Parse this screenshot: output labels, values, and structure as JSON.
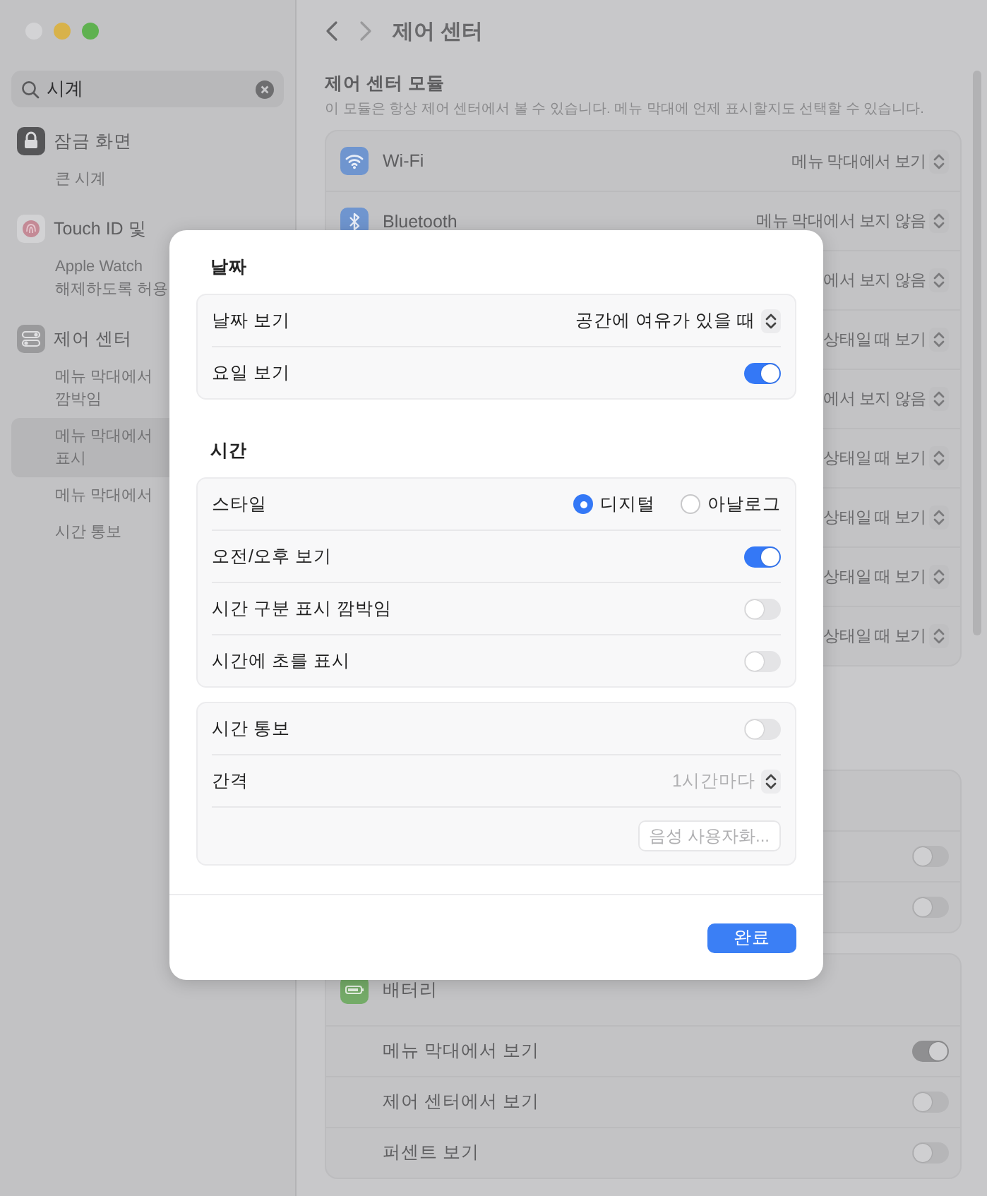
{
  "sidebar": {
    "search": {
      "value": "시계"
    },
    "groups": [
      {
        "title": "잠금 화면",
        "kind": "lock",
        "items": [
          {
            "lines": [
              "큰 시계"
            ],
            "selected": false
          }
        ]
      },
      {
        "title": "Touch ID 및",
        "kind": "fingerprint",
        "items": [
          {
            "lines": [
              "Apple Watch",
              "해제하도록 허용"
            ],
            "selected": false
          }
        ]
      },
      {
        "title": "제어 센터",
        "kind": "switches",
        "items": [
          {
            "lines": [
              "메뉴 막대에서",
              "깜박임"
            ],
            "selected": false
          },
          {
            "lines": [
              "메뉴 막대에서",
              "표시"
            ],
            "selected": true
          },
          {
            "lines": [
              "메뉴 막대에서"
            ],
            "selected": false
          },
          {
            "lines": [
              "시간 통보"
            ],
            "selected": false
          }
        ]
      }
    ]
  },
  "main": {
    "title": "제어 센터",
    "section": {
      "title": "제어 센터 모듈",
      "description": "이 모듈은 항상 제어 센터에서 볼 수 있습니다. 메뉴 막대에 언제 표시할지도 선택할 수 있습니다."
    },
    "modules": [
      {
        "kind": "wifi",
        "label": "Wi-Fi",
        "value": "메뉴 막대에서 보기"
      },
      {
        "kind": "bluetooth",
        "label": "Bluetooth",
        "value": "메뉴 막대에서 보지 않음"
      },
      {
        "value": "에서 보지 않음"
      },
      {
        "value": "상태일 때 보기"
      },
      {
        "value": "에서 보지 않음"
      },
      {
        "value": "상태일 때 보기"
      },
      {
        "value": "상태일 때 보기"
      },
      {
        "value": "상태일 때 보기"
      },
      {
        "value": "상태일 때 보기"
      }
    ],
    "hidden_card": {
      "toggles": [
        {
          "on": false
        },
        {
          "on": false
        }
      ]
    },
    "battery": {
      "title": "배터리",
      "options": [
        {
          "label": "메뉴 막대에서 보기",
          "on": true
        },
        {
          "label": "제어 센터에서 보기",
          "on": false
        },
        {
          "label": "퍼센트 보기",
          "on": false
        }
      ]
    }
  },
  "dialog": {
    "groups": [
      {
        "title": "날짜",
        "rows": [
          {
            "kind": "popup",
            "label": "날짜 보기",
            "value": "공간에 여유가 있을 때",
            "disabled": false
          },
          {
            "kind": "toggle",
            "label": "요일 보기",
            "on": true
          }
        ]
      },
      {
        "title": "시간",
        "rows": [
          {
            "kind": "radio",
            "label": "스타일",
            "options": [
              {
                "label": "디지털",
                "selected": true
              },
              {
                "label": "아날로그",
                "selected": false
              }
            ]
          },
          {
            "kind": "toggle",
            "label": "오전/오후 보기",
            "on": true
          },
          {
            "kind": "toggle",
            "label": "시간 구분 표시 깜박임",
            "on": false
          },
          {
            "kind": "toggle",
            "label": "시간에 초를 표시",
            "on": false
          }
        ]
      },
      {
        "rows": [
          {
            "kind": "toggle",
            "label": "시간 통보",
            "on": false
          },
          {
            "kind": "popup",
            "label": "간격",
            "value": "1시간마다",
            "disabled": true
          },
          {
            "kind": "button",
            "label": "음성 사용자화...",
            "disabled": true
          }
        ]
      }
    ],
    "done_button": "완료"
  }
}
